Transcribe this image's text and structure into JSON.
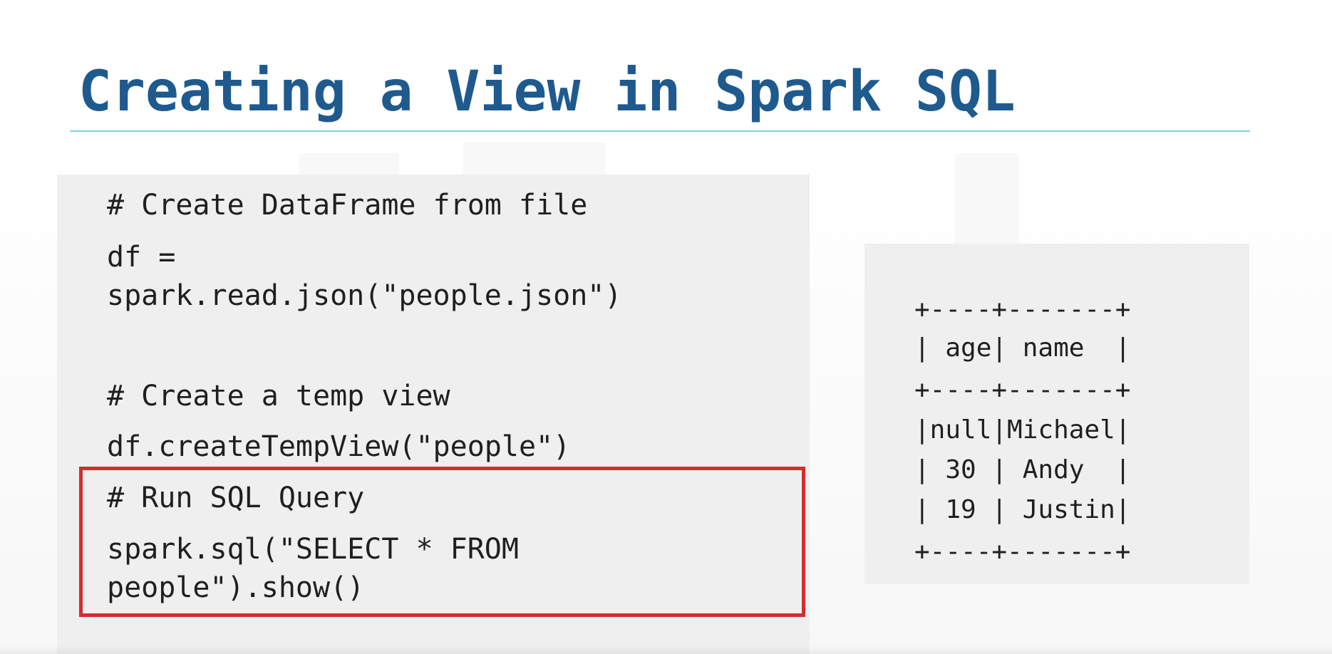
{
  "slide": {
    "title": "Creating a View in Spark SQL"
  },
  "code": {
    "lines": [
      "# Create DataFrame from file",
      "df =",
      "spark.read.json(\"people.json\")",
      "# Create a temp view",
      "df.createTempView(\"people\")",
      "# Run SQL Query",
      "spark.sql(\"SELECT * FROM",
      "people\").show()"
    ]
  },
  "output": {
    "lines": [
      "+----+-------+",
      "| age| name  |",
      "+----+-------+",
      "|null|Michael|",
      "| 30 | Andy  |",
      "| 19 | Justin|",
      "+----+-------+"
    ]
  },
  "colors": {
    "title": "#1f5a8e",
    "title_rule": "#7fd2ea",
    "panel_bg": "#efefef",
    "highlight_border": "#d22e2e",
    "code_text": "#1f1f1f"
  }
}
